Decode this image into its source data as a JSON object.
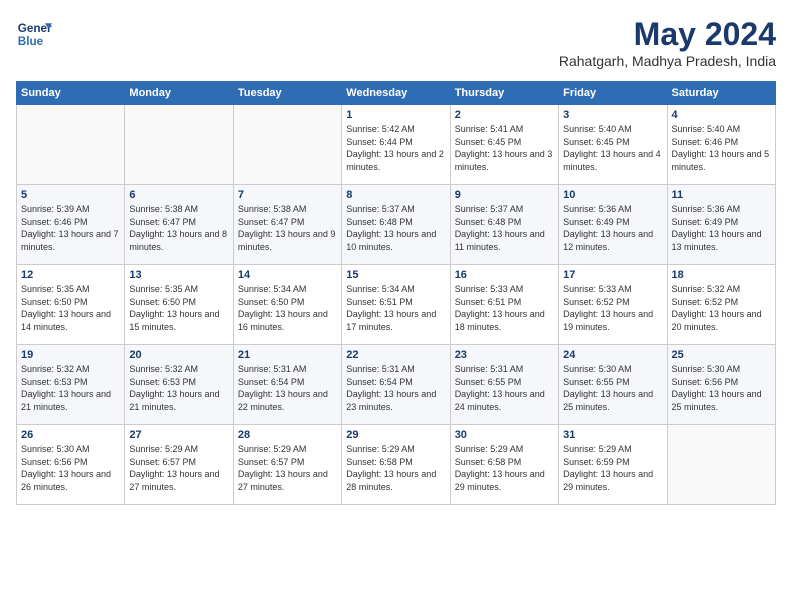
{
  "header": {
    "logo_line1": "General",
    "logo_line2": "Blue",
    "month_year": "May 2024",
    "location": "Rahatgarh, Madhya Pradesh, India"
  },
  "days_of_week": [
    "Sunday",
    "Monday",
    "Tuesday",
    "Wednesday",
    "Thursday",
    "Friday",
    "Saturday"
  ],
  "weeks": [
    [
      {
        "day": "",
        "content": ""
      },
      {
        "day": "",
        "content": ""
      },
      {
        "day": "",
        "content": ""
      },
      {
        "day": "1",
        "content": "Sunrise: 5:42 AM\nSunset: 6:44 PM\nDaylight: 13 hours and 2 minutes."
      },
      {
        "day": "2",
        "content": "Sunrise: 5:41 AM\nSunset: 6:45 PM\nDaylight: 13 hours and 3 minutes."
      },
      {
        "day": "3",
        "content": "Sunrise: 5:40 AM\nSunset: 6:45 PM\nDaylight: 13 hours and 4 minutes."
      },
      {
        "day": "4",
        "content": "Sunrise: 5:40 AM\nSunset: 6:46 PM\nDaylight: 13 hours and 5 minutes."
      }
    ],
    [
      {
        "day": "5",
        "content": "Sunrise: 5:39 AM\nSunset: 6:46 PM\nDaylight: 13 hours and 7 minutes."
      },
      {
        "day": "6",
        "content": "Sunrise: 5:38 AM\nSunset: 6:47 PM\nDaylight: 13 hours and 8 minutes."
      },
      {
        "day": "7",
        "content": "Sunrise: 5:38 AM\nSunset: 6:47 PM\nDaylight: 13 hours and 9 minutes."
      },
      {
        "day": "8",
        "content": "Sunrise: 5:37 AM\nSunset: 6:48 PM\nDaylight: 13 hours and 10 minutes."
      },
      {
        "day": "9",
        "content": "Sunrise: 5:37 AM\nSunset: 6:48 PM\nDaylight: 13 hours and 11 minutes."
      },
      {
        "day": "10",
        "content": "Sunrise: 5:36 AM\nSunset: 6:49 PM\nDaylight: 13 hours and 12 minutes."
      },
      {
        "day": "11",
        "content": "Sunrise: 5:36 AM\nSunset: 6:49 PM\nDaylight: 13 hours and 13 minutes."
      }
    ],
    [
      {
        "day": "12",
        "content": "Sunrise: 5:35 AM\nSunset: 6:50 PM\nDaylight: 13 hours and 14 minutes."
      },
      {
        "day": "13",
        "content": "Sunrise: 5:35 AM\nSunset: 6:50 PM\nDaylight: 13 hours and 15 minutes."
      },
      {
        "day": "14",
        "content": "Sunrise: 5:34 AM\nSunset: 6:50 PM\nDaylight: 13 hours and 16 minutes."
      },
      {
        "day": "15",
        "content": "Sunrise: 5:34 AM\nSunset: 6:51 PM\nDaylight: 13 hours and 17 minutes."
      },
      {
        "day": "16",
        "content": "Sunrise: 5:33 AM\nSunset: 6:51 PM\nDaylight: 13 hours and 18 minutes."
      },
      {
        "day": "17",
        "content": "Sunrise: 5:33 AM\nSunset: 6:52 PM\nDaylight: 13 hours and 19 minutes."
      },
      {
        "day": "18",
        "content": "Sunrise: 5:32 AM\nSunset: 6:52 PM\nDaylight: 13 hours and 20 minutes."
      }
    ],
    [
      {
        "day": "19",
        "content": "Sunrise: 5:32 AM\nSunset: 6:53 PM\nDaylight: 13 hours and 21 minutes."
      },
      {
        "day": "20",
        "content": "Sunrise: 5:32 AM\nSunset: 6:53 PM\nDaylight: 13 hours and 21 minutes."
      },
      {
        "day": "21",
        "content": "Sunrise: 5:31 AM\nSunset: 6:54 PM\nDaylight: 13 hours and 22 minutes."
      },
      {
        "day": "22",
        "content": "Sunrise: 5:31 AM\nSunset: 6:54 PM\nDaylight: 13 hours and 23 minutes."
      },
      {
        "day": "23",
        "content": "Sunrise: 5:31 AM\nSunset: 6:55 PM\nDaylight: 13 hours and 24 minutes."
      },
      {
        "day": "24",
        "content": "Sunrise: 5:30 AM\nSunset: 6:55 PM\nDaylight: 13 hours and 25 minutes."
      },
      {
        "day": "25",
        "content": "Sunrise: 5:30 AM\nSunset: 6:56 PM\nDaylight: 13 hours and 25 minutes."
      }
    ],
    [
      {
        "day": "26",
        "content": "Sunrise: 5:30 AM\nSunset: 6:56 PM\nDaylight: 13 hours and 26 minutes."
      },
      {
        "day": "27",
        "content": "Sunrise: 5:29 AM\nSunset: 6:57 PM\nDaylight: 13 hours and 27 minutes."
      },
      {
        "day": "28",
        "content": "Sunrise: 5:29 AM\nSunset: 6:57 PM\nDaylight: 13 hours and 27 minutes."
      },
      {
        "day": "29",
        "content": "Sunrise: 5:29 AM\nSunset: 6:58 PM\nDaylight: 13 hours and 28 minutes."
      },
      {
        "day": "30",
        "content": "Sunrise: 5:29 AM\nSunset: 6:58 PM\nDaylight: 13 hours and 29 minutes."
      },
      {
        "day": "31",
        "content": "Sunrise: 5:29 AM\nSunset: 6:59 PM\nDaylight: 13 hours and 29 minutes."
      },
      {
        "day": "",
        "content": ""
      }
    ]
  ]
}
